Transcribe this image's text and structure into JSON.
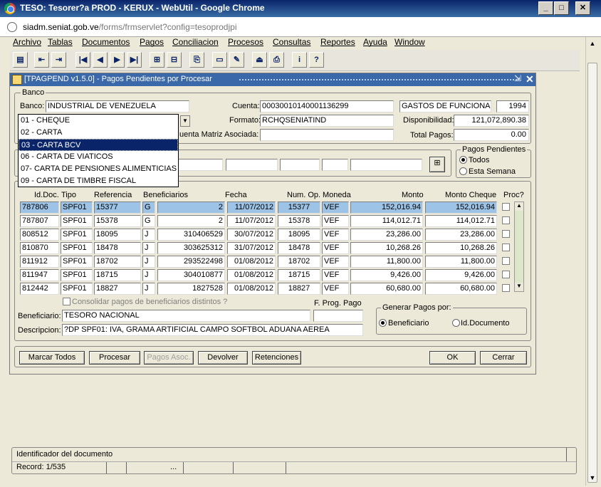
{
  "window": {
    "title": "TESO: Tesorer?a PROD - KERUX - WebUtil - Google Chrome",
    "url_host": "siadm.seniat.gob.ve",
    "url_path": "/forms/frmservlet?config=tesoprodjpi"
  },
  "menu": [
    "Archivo",
    "Tablas",
    "Documentos",
    "Pagos",
    "Conciliacion",
    "Procesos",
    "Consultas",
    "Reportes",
    "Ayuda",
    "Window"
  ],
  "form": {
    "title": "[TPAGPEND v1.5.0] - Pagos Pendientes por Procesar",
    "banco_group": "Banco",
    "banco_label": "Banco:",
    "banco_value": "INDUSTRIAL DE VENEZUELA",
    "cuenta_label": "Cuenta:",
    "cuenta_value": "00030010140001136299",
    "cuenta_desc": "GASTOS DE FUNCIONAMIE",
    "cuenta_year": "1994",
    "formato_label": "Formato:",
    "formato_value": "RCHQSENIATIND",
    "disponibilidad_label": "Disponibilidad:",
    "disponibilidad_value": "121,072,890.38",
    "matriz_label": "uenta Matriz Asociada:",
    "total_label": "Total Pagos:",
    "total_value": "0.00",
    "dropdown": [
      "01 - CHEQUE",
      "02 - CARTA",
      "03 - CARTA BCV",
      "06 - CARTA DE VIATICOS",
      "07- CARTA DE PENSIONES ALIMENTICIAS",
      "09 - CARTA DE TIMBRE FISCAL"
    ],
    "pagos_group": "Pagos Pendientes",
    "radio_todos": "Todos",
    "radio_semana": "Esta Semana"
  },
  "table": {
    "headers": [
      "Id.Doc.",
      "Tipo",
      "Referencia",
      "Beneficiarios",
      "Fecha",
      "Num. Op.",
      "Moneda",
      "Monto",
      "Monto Cheque",
      "Proc?"
    ],
    "rows": [
      [
        "787806",
        "SPF01",
        "15377",
        "G",
        "2",
        "11/07/2012",
        "15377",
        "VEF",
        "152,016.94",
        "152,016.94"
      ],
      [
        "787807",
        "SPF01",
        "15378",
        "G",
        "2",
        "11/07/2012",
        "15378",
        "VEF",
        "114,012.71",
        "114,012.71"
      ],
      [
        "808512",
        "SPF01",
        "18095",
        "J",
        "310406529",
        "30/07/2012",
        "18095",
        "VEF",
        "23,286.00",
        "23,286.00"
      ],
      [
        "810870",
        "SPF01",
        "18478",
        "J",
        "303625312",
        "31/07/2012",
        "18478",
        "VEF",
        "10,268.26",
        "10,268.26"
      ],
      [
        "811912",
        "SPF01",
        "18702",
        "J",
        "293522498",
        "01/08/2012",
        "18702",
        "VEF",
        "11,800.00",
        "11,800.00"
      ],
      [
        "811947",
        "SPF01",
        "18715",
        "J",
        "304010877",
        "01/08/2012",
        "18715",
        "VEF",
        "9,426.00",
        "9,426.00"
      ],
      [
        "812442",
        "SPF01",
        "18827",
        "J",
        "1827528",
        "01/08/2012",
        "18827",
        "VEF",
        "60,680.00",
        "60,680.00"
      ]
    ]
  },
  "detail": {
    "consolidar": "Consolidar pagos de beneficiarios distintos ?",
    "fprog_label": "F. Prog. Pago",
    "beneficiario_label": "Beneficiario:",
    "beneficiario_value": "TESORO NACIONAL",
    "descripcion_label": "Descripcion:",
    "descripcion_value": "?DP SPF01: IVA, GRAMA ARTIFICIAL CAMPO SOFTBOL ADUANA AEREA",
    "generar_group": "Generar Pagos por:",
    "radio_benef": "Beneficiario",
    "radio_iddoc": "Id.Documento"
  },
  "buttons": {
    "marcar": "Marcar Todos",
    "procesar": "Procesar",
    "pagos_asoc": "Pagos Asoc.",
    "devolver": "Devolver",
    "retenciones": "Retenciones",
    "ok": "OK",
    "cerrar": "Cerrar"
  },
  "status": {
    "message": "Identificador del documento",
    "record": "Record: 1/535",
    "ellipsis": "..."
  }
}
